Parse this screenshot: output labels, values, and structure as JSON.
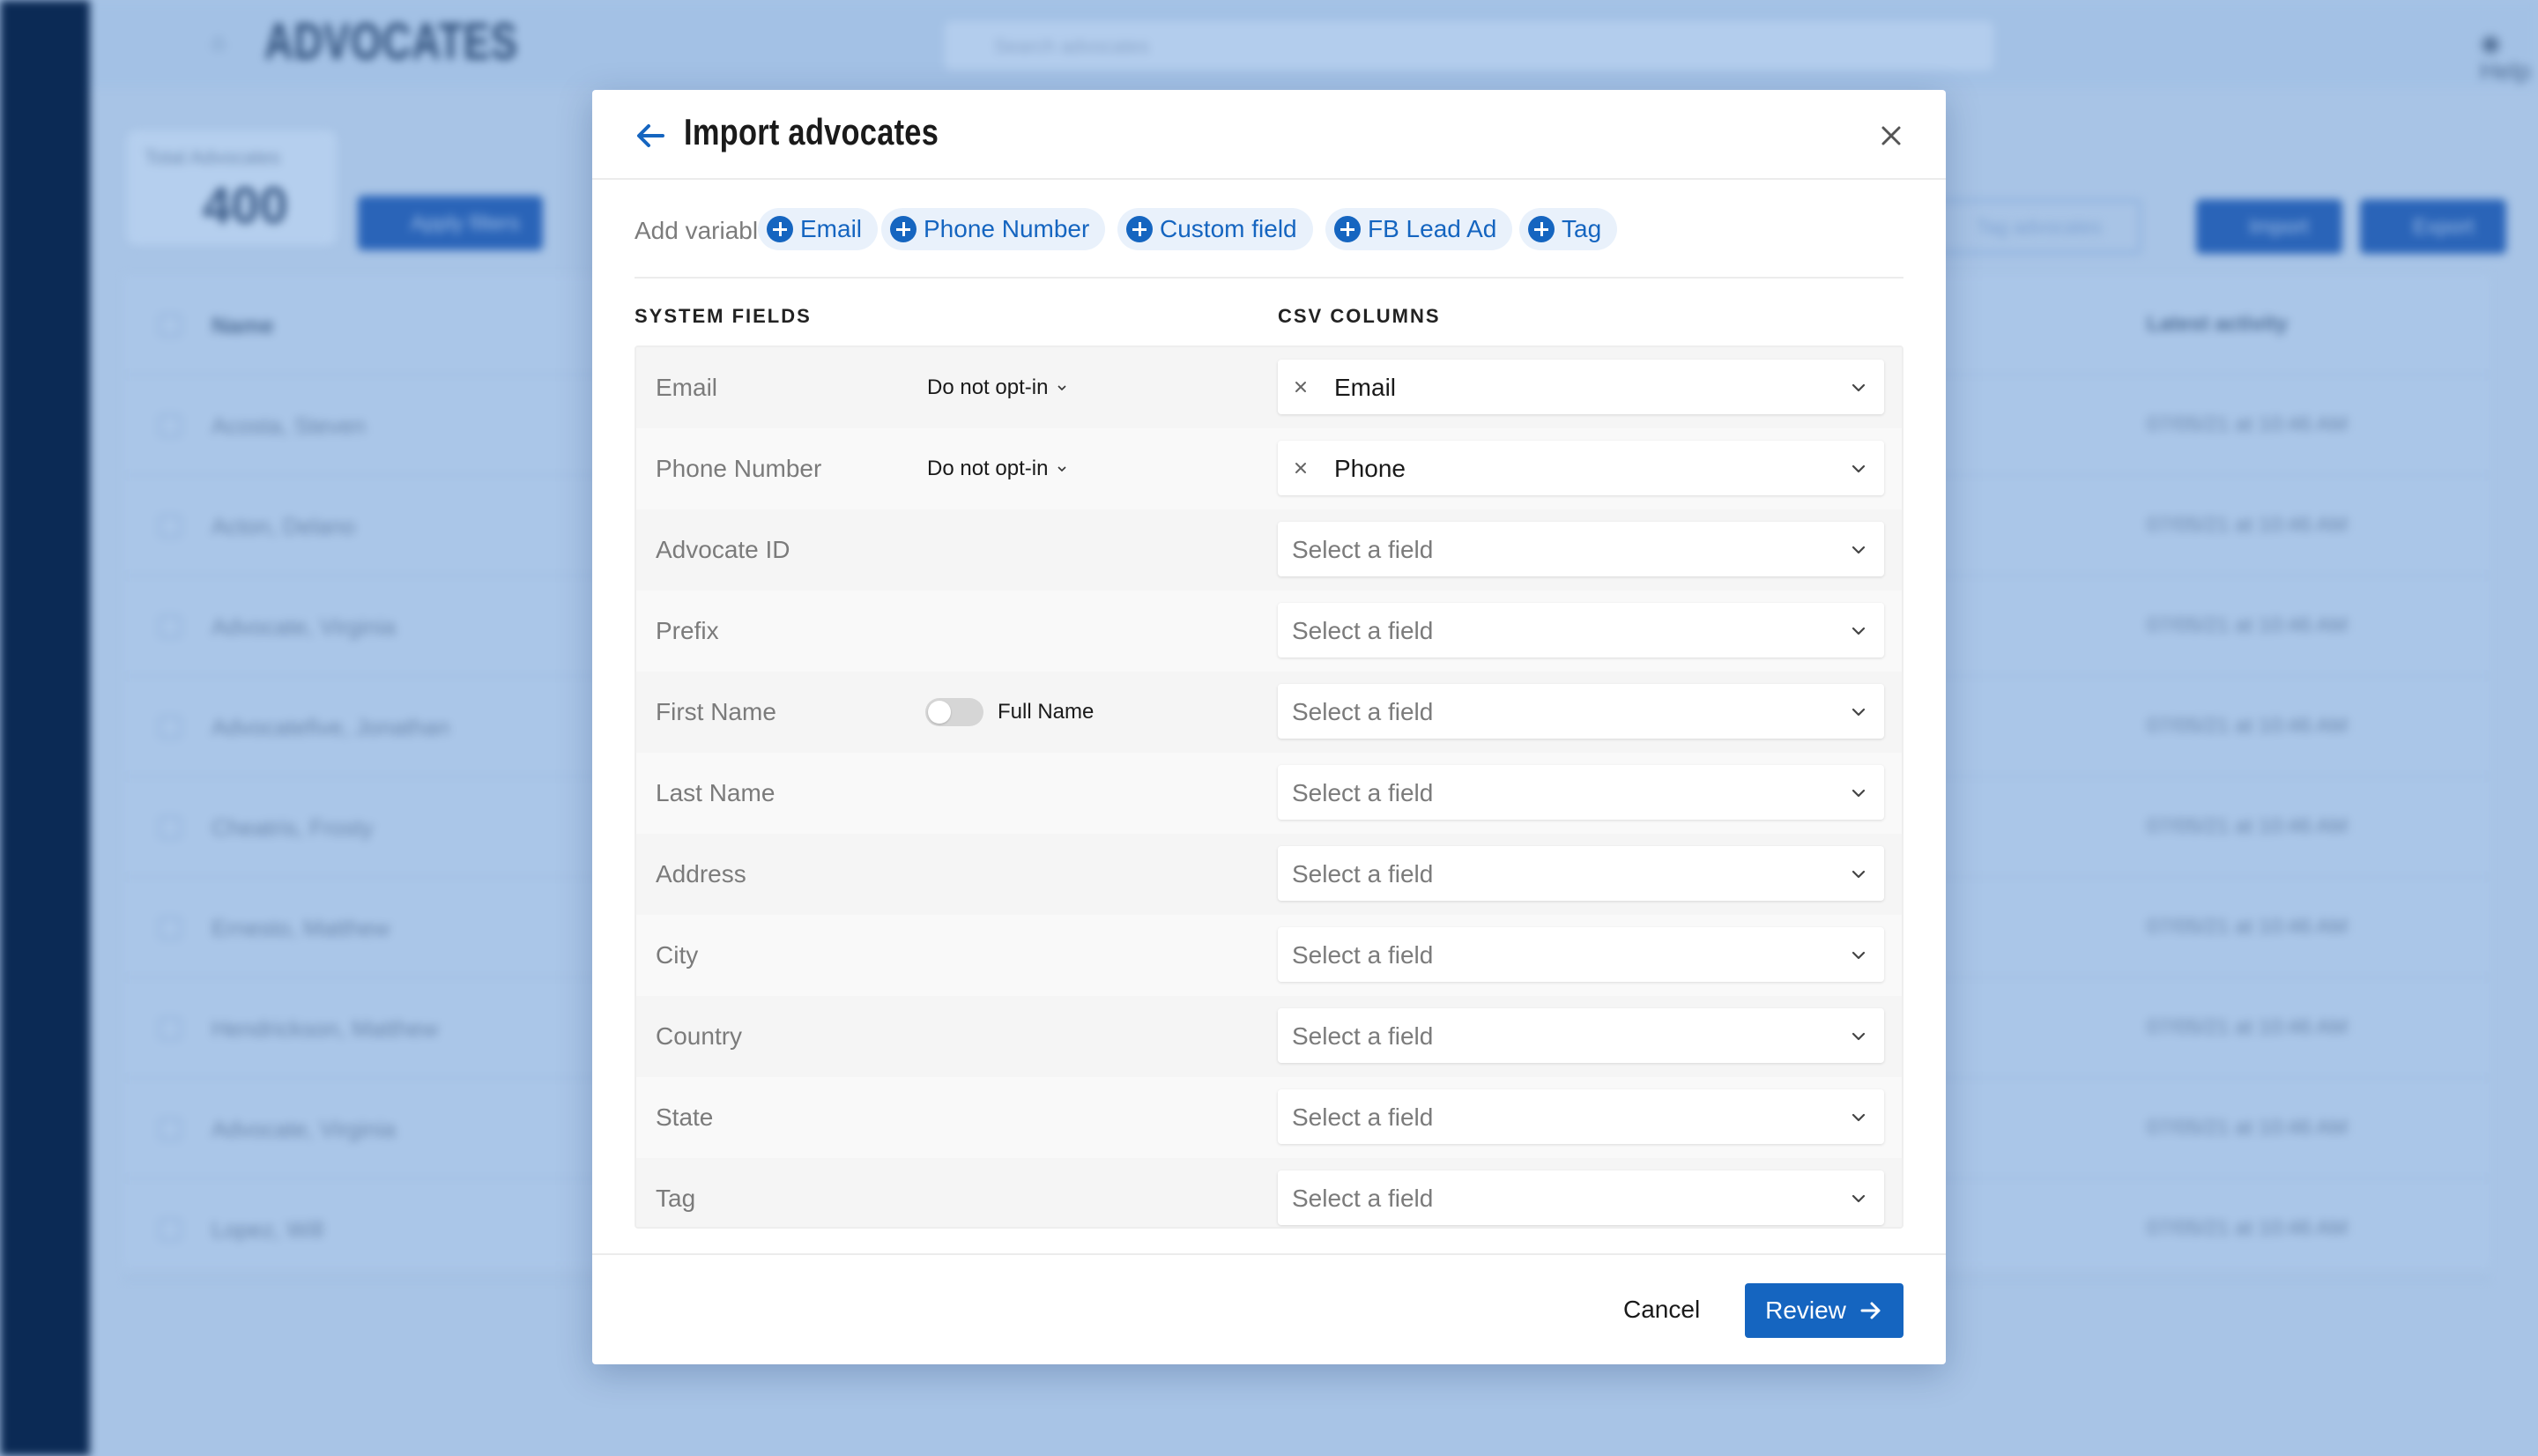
{
  "background": {
    "app_title": "ADVOCATES",
    "search_placeholder": "Search advocates",
    "help_label": "Help",
    "stat_label": "Total Advocates",
    "stat_value": "400",
    "apply_filters_label": "Apply filters",
    "tag_advocates_label": "Tag advocates",
    "import_label": "Import",
    "export_label": "Export",
    "table_headers": {
      "name": "Name",
      "latest_activity": "Latest activity"
    },
    "rows": [
      {
        "name": "Acosta, Steven",
        "date": "07/05/21 at 10:46 AM"
      },
      {
        "name": "Acton, Delano",
        "date": "07/05/21 at 10:46 AM"
      },
      {
        "name": "Advocate, Virginia",
        "date": "07/05/21 at 10:46 AM"
      },
      {
        "name": "Advocatefive, Jonathan",
        "date": "07/05/21 at 10:46 AM"
      },
      {
        "name": "Cheatris, Frosty",
        "date": "07/05/21 at 10:46 AM"
      },
      {
        "name": "Ernesto, Matthew",
        "date": "07/05/21 at 10:46 AM"
      },
      {
        "name": "Hendrickson, Matthew",
        "date": "07/05/21 at 10:46 AM"
      },
      {
        "name": "Advocate, Virginia",
        "date": "07/05/21 at 10:46 AM"
      },
      {
        "name": "Lopez, Will",
        "date": "07/05/21 at 10:46 AM"
      }
    ]
  },
  "modal": {
    "title": "Import advocates",
    "variable_fields_label": "Add variable fields",
    "variable_chips": [
      "Email",
      "Phone Number",
      "Custom field",
      "FB Lead Ad",
      "Tag"
    ],
    "system_fields_header": "SYSTEM FIELDS",
    "csv_columns_header": "CSV COLUMNS",
    "optin_label": "Do not opt-in",
    "full_name_label": "Full Name",
    "select_placeholder": "Select a field",
    "fields": [
      {
        "name": "Email",
        "csv": "Email"
      },
      {
        "name": "Phone Number",
        "csv": "Phone"
      },
      {
        "name": "Advocate ID",
        "csv": ""
      },
      {
        "name": "Prefix",
        "csv": ""
      },
      {
        "name": "First Name",
        "csv": ""
      },
      {
        "name": "Last Name",
        "csv": ""
      },
      {
        "name": "Address",
        "csv": ""
      },
      {
        "name": "City",
        "csv": ""
      },
      {
        "name": "Country",
        "csv": ""
      },
      {
        "name": "State",
        "csv": ""
      },
      {
        "name": "Tag",
        "csv": ""
      }
    ],
    "cancel_label": "Cancel",
    "review_label": "Review"
  },
  "colors": {
    "accent": "#1565c0",
    "sidebar": "#0b2a55",
    "overlay": "#a8c4e6"
  }
}
